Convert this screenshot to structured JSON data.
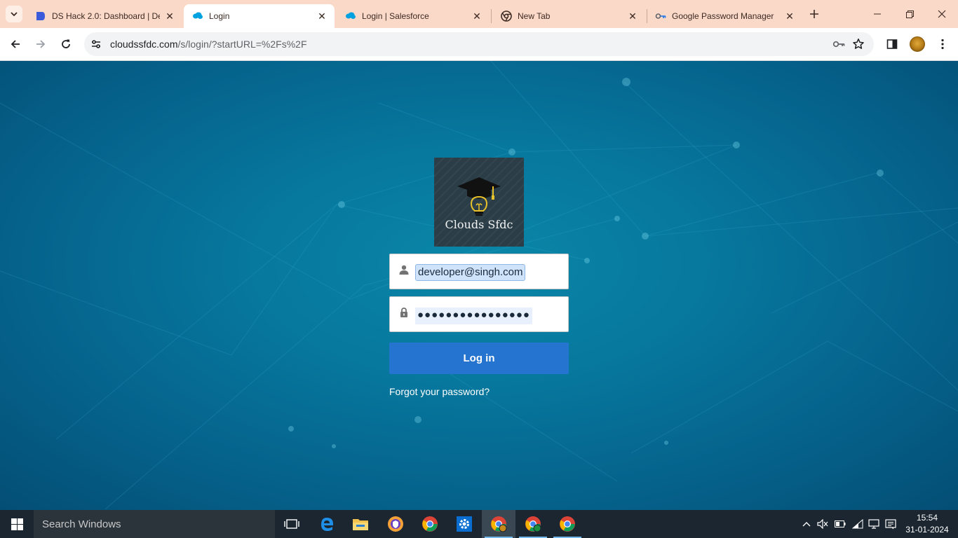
{
  "browser": {
    "tabs": [
      {
        "title": "DS Hack 2.0: Dashboard | De",
        "favicon": "ds-hack-icon",
        "active": false
      },
      {
        "title": "Login",
        "favicon": "salesforce-cloud-icon",
        "active": true
      },
      {
        "title": "Login | Salesforce",
        "favicon": "salesforce-cloud-icon",
        "active": false
      },
      {
        "title": "New Tab",
        "favicon": "chrome-icon",
        "active": false
      },
      {
        "title": "Google Password Manager",
        "favicon": "password-manager-key-icon",
        "active": false
      }
    ],
    "url_host": "cloudssfdc.com",
    "url_path": "/s/login/?startURL=%2Fs%2F"
  },
  "login": {
    "logo_text": "Clouds Sfdc",
    "username": "developer@singh.com",
    "password_mask": "●●●●●●●●●●●●●●●●",
    "login_button": "Log in",
    "forgot_link": "Forgot your password?"
  },
  "taskbar": {
    "search_placeholder": "Search Windows",
    "time": "15:54",
    "date": "31-01-2024",
    "apps": [
      "task-view",
      "edge",
      "file-explorer",
      "brave",
      "chrome",
      "settings",
      "chrome-profile-1",
      "chrome-profile-2",
      "chrome-profile-3"
    ]
  },
  "colors": {
    "tabstrip": "#fbd9c9",
    "page_bg": "#07779d",
    "login_button": "#2574cf",
    "taskbar": "#1b2630"
  }
}
